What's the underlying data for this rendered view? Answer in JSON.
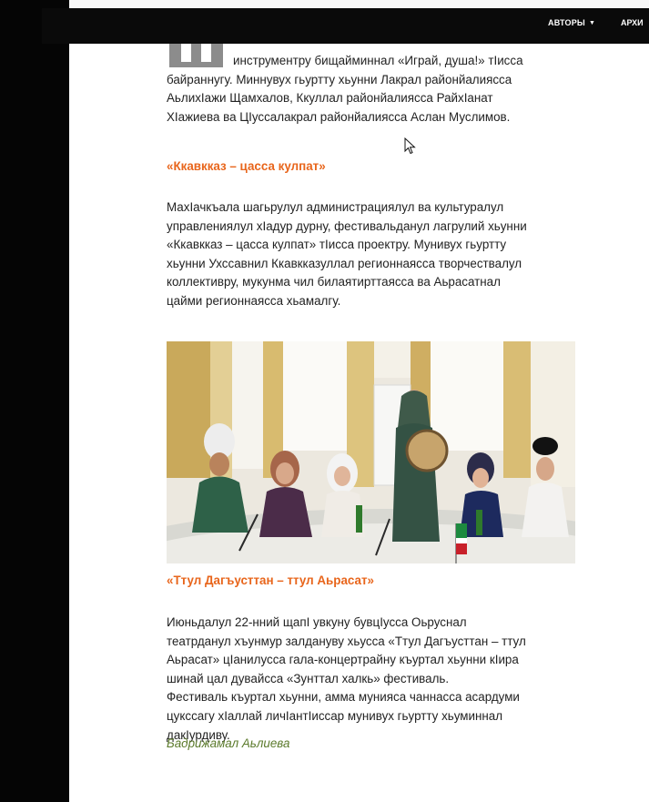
{
  "nav": {
    "authors_label": "АВТОРЫ",
    "archive_label": "АРХИ"
  },
  "article": {
    "intro_lines": [
      "инструментру бищайминнал «Играй, душа!» тӀисса",
      "байраннугу. Миннувух гьуртту хьунни Лакрал районйалиясса",
      "АьлихӀажи Щамхалов, Ккуллал районйалиясса РайхӀанат",
      "ХӀажиева ва ЦӀуссалакрал районйалиясса Аслан Муслимов."
    ],
    "heading_1": "«Ккавкказ – цасса кулпат»",
    "para_2_lines": [
      "МахӀачкъала шагьрулул администрациялул ва культуралул",
      "управлениялул хӀадур дурну, фестивальданул лагрулий хьунни",
      "«Ккавкказ – цасса кулпат» тӀисса проектру. Мунивух гьуртту",
      "хьунни Ухссавнил Ккавкказуллал регионнаясса творчествалул",
      "коллективру, мукунма чил билаятирттаясса ва Аьрасатнал",
      "цайми регионнаясса хьамалгу."
    ],
    "photo_caption": "«Ттул Дагъусттан – ттул Аьрасат»",
    "para_3_lines": [
      "Июньдалул 22-нний щапӀ увкуну бувцӀусса Оьруснал",
      "театрданул хъунмур залдануву хьусса «Ттул Дагъусттан – ттул",
      "Аьрасат» цӀанилусса гала-концертрайну къуртал хьунни кӀира",
      "шинай цал дувайсса «Зунттал халкь» фестиваль.",
      "Фестиваль къуртал хьунни, амма мунияса чаннасса асардуми",
      "цукссагу хӀаллай личӀантӀиссар мунивух гьуртту хьуминнал",
      "дакӀурдиву."
    ],
    "author": "Бадрижамал Аьлиева"
  },
  "colors": {
    "accent": "#e8651b",
    "author": "#5b7a2b",
    "nav_bg": "#0a0a0a"
  }
}
